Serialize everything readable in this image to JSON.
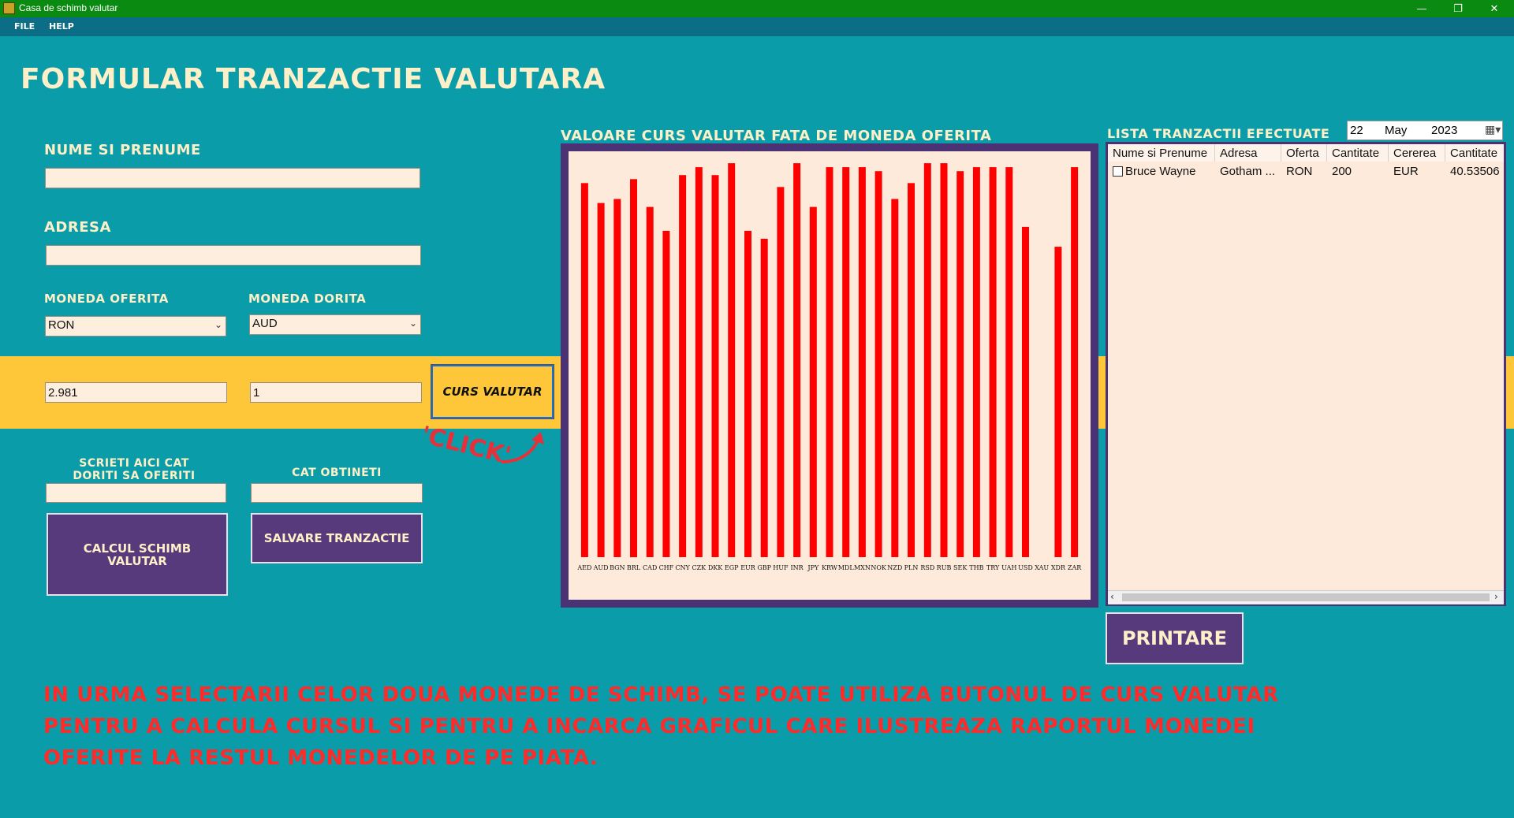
{
  "window": {
    "title": "Casa de schimb valutar"
  },
  "menu": {
    "file": "FILE",
    "help": "HELP"
  },
  "form": {
    "title": "FORMULAR TRANZACTIE VALUTARA",
    "name_label": "NUME SI PRENUME",
    "name_value": "",
    "address_label": "ADRESA",
    "address_value": "",
    "offered_label": "MONEDA OFERITA",
    "offered_value": "RON",
    "desired_label": "MONEDA DORITA",
    "desired_value": "AUD",
    "rate_offered_value": "2.981",
    "rate_desired_value": "1",
    "rate_button": "CURS VALUTAR",
    "click_hint": "'CLICK'",
    "amount_label_line1": "SCRIETI AICI CAT",
    "amount_label_line2": "DORITI SA OFERITI",
    "result_label": "CAT OBTINETI",
    "amount_value": "",
    "result_value": "",
    "calc_button_line1": "CALCUL SCHIMB",
    "calc_button_line2": "VALUTAR",
    "save_button": "SALVARE TRANZACTIE"
  },
  "chart_data": {
    "type": "bar",
    "title": "VALOARE CURS VALUTAR FATA DE MONEDA OFERITA",
    "bar_color": "#ff0000",
    "categories": [
      "AED",
      "AUD",
      "BGN",
      "BRL",
      "CAD",
      "CHF",
      "CNY",
      "CZK",
      "DKK",
      "EGP",
      "EUR",
      "GBP",
      "HUF",
      "INR",
      "JPY",
      "KRW",
      "MDL",
      "MXN",
      "NOK",
      "NZD",
      "PLN",
      "RSD",
      "RUB",
      "SEK",
      "THB",
      "TRY",
      "UAH",
      "USD",
      "XAU",
      "XDR",
      "ZAR"
    ],
    "values": [
      0.94,
      0.89,
      0.9,
      0.95,
      0.88,
      0.82,
      0.96,
      0.98,
      0.96,
      0.99,
      0.82,
      0.8,
      0.93,
      0.99,
      0.88,
      0.98,
      0.98,
      0.98,
      0.97,
      0.9,
      0.94,
      0.99,
      0.99,
      0.97,
      0.98,
      0.98,
      0.98,
      0.83,
      0,
      0.78,
      0.98
    ],
    "ylim": [
      0,
      1
    ]
  },
  "transactions": {
    "title": "LISTA TRANZACTII EFECTUATE",
    "date": {
      "day": "22",
      "month": "May",
      "year": "2023"
    },
    "columns": [
      "Nume si Prenume",
      "Adresa",
      "Oferta",
      "Cantitate",
      "Cererea",
      "Cantitate"
    ],
    "rows": [
      {
        "name": "Bruce Wayne",
        "address": "Gotham ...",
        "offer": "RON",
        "qty": "200",
        "demand": "EUR",
        "qty2": "40.53506"
      }
    ],
    "print_button": "PRINTARE"
  },
  "note": {
    "line1": "IN URMA SELECTARII CELOR DOUA MONEDE DE SCHIMB, SE POATE UTILIZA BUTONUL DE CURS VALUTAR",
    "line2": "PENTRU A CALCULA CURSUL SI PENTRU A INCARCA GRAFICUL CARE ILUSTREAZA RAPORTUL MONEDEI",
    "line3": "OFERITE LA RESTUL MONEDELOR DE PE PIATA."
  }
}
